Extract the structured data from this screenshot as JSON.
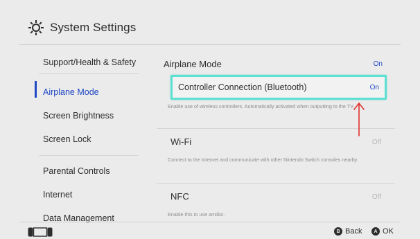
{
  "header": {
    "title": "System Settings",
    "icon": "gear-icon"
  },
  "sidebar": {
    "items": [
      {
        "label": "Support/Health & Safety"
      },
      {
        "label": "Airplane Mode",
        "active": true
      },
      {
        "label": "Screen Brightness"
      },
      {
        "label": "Screen Lock"
      },
      {
        "label": "Parental Controls"
      },
      {
        "label": "Internet"
      },
      {
        "label": "Data Management"
      }
    ]
  },
  "content": {
    "airplane_mode": {
      "label": "Airplane Mode",
      "value": "On"
    },
    "controller": {
      "label": "Controller Connection (Bluetooth)",
      "value": "On",
      "description": "Enable use of wireless controllers. Automatically activated when outputting to the TV."
    },
    "wifi": {
      "label": "Wi-Fi",
      "value": "Off",
      "description": "Connect to the Internet and communicate with other Nintendo Switch consoles nearby."
    },
    "nfc": {
      "label": "NFC",
      "value": "Off",
      "description": "Enable this to use amiibo."
    }
  },
  "footer": {
    "back": {
      "glyph": "B",
      "label": "Back"
    },
    "ok": {
      "glyph": "A",
      "label": "OK"
    }
  },
  "colors": {
    "accent": "#1f47c4",
    "focus_border": "#5ce0d2",
    "annotation_arrow": "#e0302c",
    "background": "#ebebeb"
  }
}
